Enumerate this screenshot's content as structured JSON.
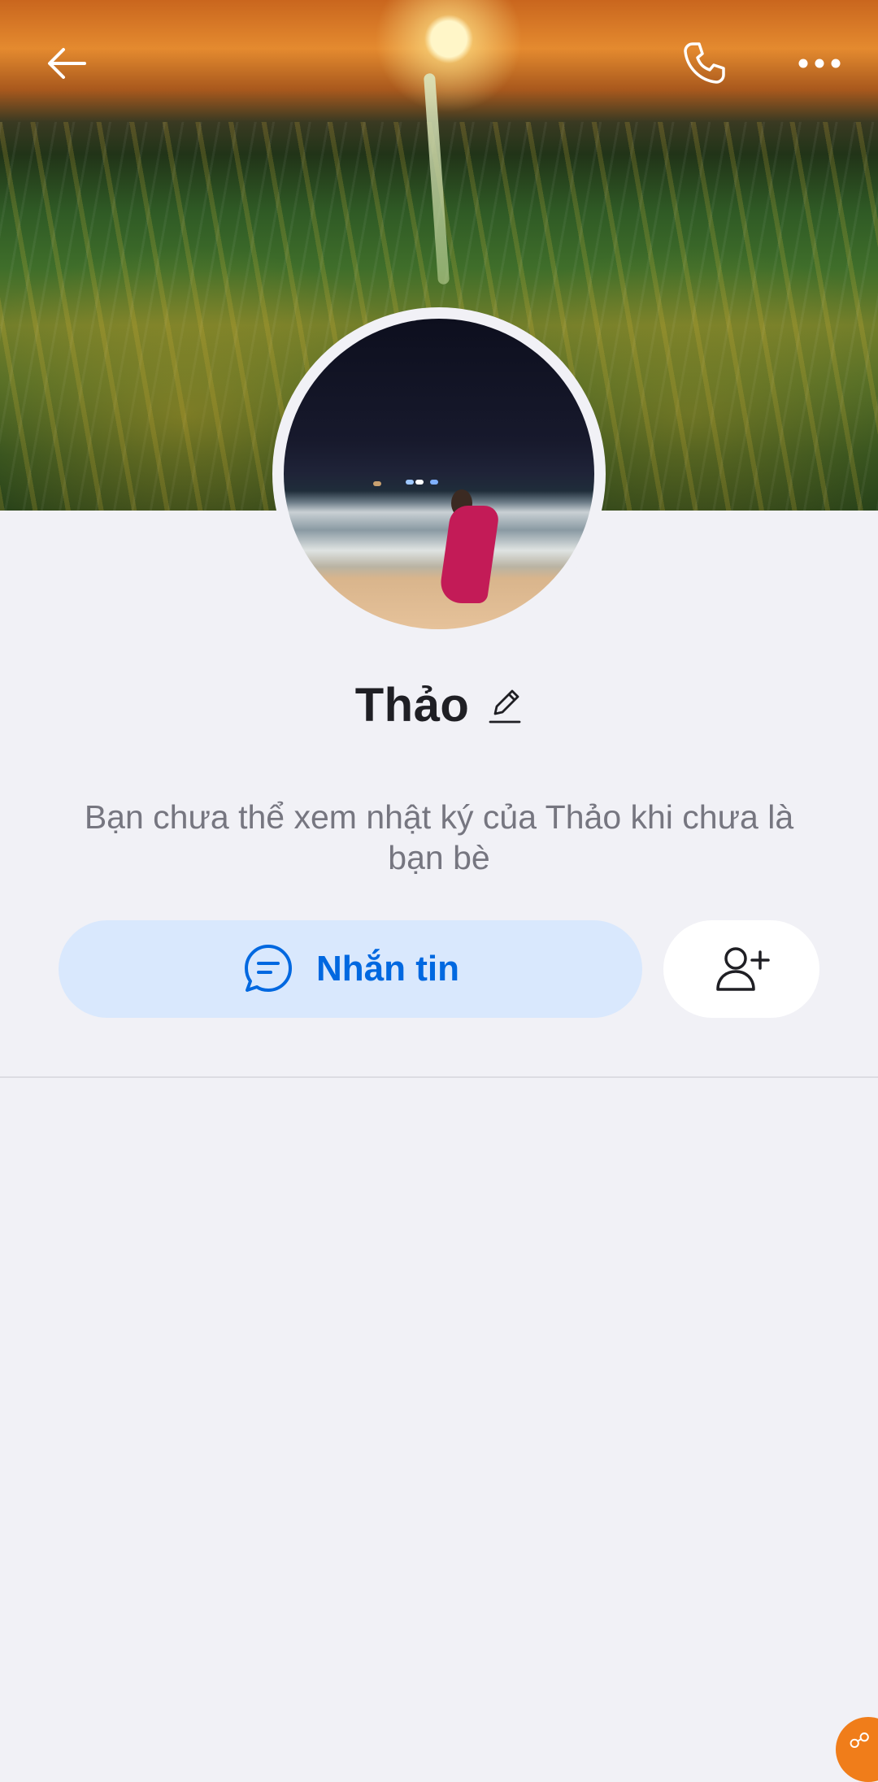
{
  "header": {
    "back_icon": "arrow-left-icon",
    "call_icon": "phone-icon",
    "more_icon": "more-horizontal-icon"
  },
  "profile": {
    "name": "Thảo",
    "edit_icon": "pencil-icon",
    "info_message": "Bạn chưa thể xem nhật ký của Thảo khi chưa là bạn bè"
  },
  "actions": {
    "message_label": "Nhắn tin",
    "message_icon": "chat-bubble-icon",
    "add_friend_icon": "add-user-icon"
  },
  "colors": {
    "accent": "#0068e0",
    "accent_light": "#d9e8fd",
    "background": "#f1f1f6"
  }
}
